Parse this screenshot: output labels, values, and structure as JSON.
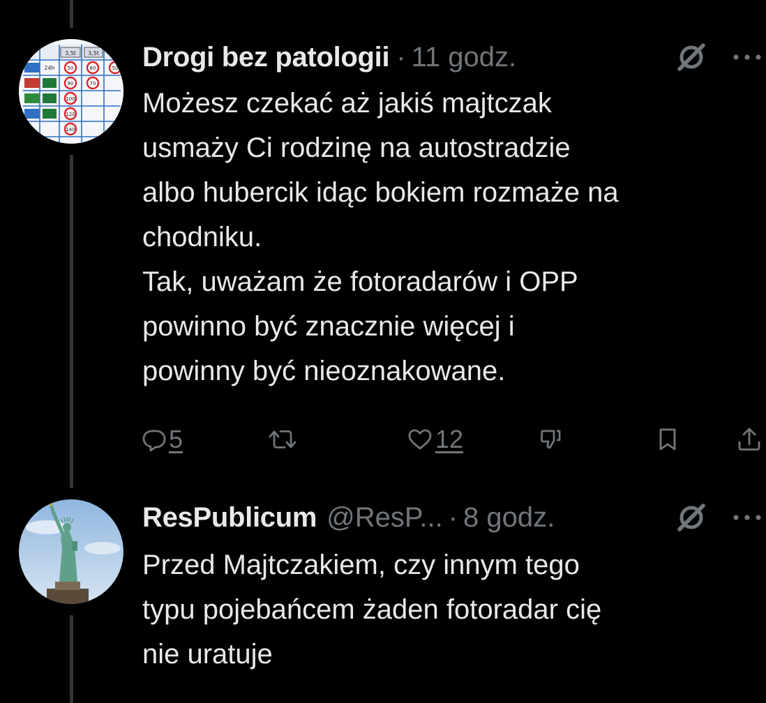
{
  "tweets": [
    {
      "name": "Drogi bez patologii",
      "handle": "",
      "separator": "·",
      "time": "11 godz.",
      "lines": [
        "Możesz czekać aż jakiś majtczak",
        "usmaży Ci rodzinę na autostradzie",
        "albo hubercik idąc bokiem rozmaże na",
        "chodniku.",
        "Tak, uważam że fotoradarów i OPP",
        "powinno być znacznie więcej i",
        "powinny być nieoznakowane."
      ],
      "avatar": {
        "cells": [
          "24h",
          "50",
          "50",
          "90",
          "70",
          "100",
          "80",
          "120",
          "140",
          "3,5t",
          "3,5t"
        ]
      },
      "actions": {
        "reply_count": "5",
        "retweet_count": "",
        "like_count": "12"
      }
    },
    {
      "name": "ResPublicum",
      "handle": "@ResP...",
      "separator": "·",
      "time": "8 godz.",
      "lines": [
        "Przed Majtczakiem, czy innym tego",
        "typu pojebańcem żaden fotoradar cię",
        "nie uratuje"
      ]
    }
  ],
  "colors": {
    "background": "#000000",
    "text": "#e7e9ea",
    "secondary": "#71767b",
    "thread_line": "#333639"
  },
  "icons": [
    "grok-icon",
    "more-icon",
    "reply-icon",
    "retweet-icon",
    "like-icon",
    "downvote-icon",
    "bookmark-icon",
    "share-icon"
  ]
}
